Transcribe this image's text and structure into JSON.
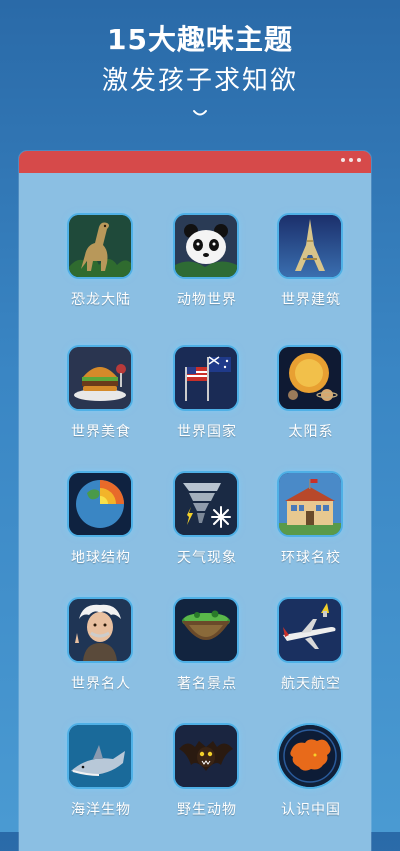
{
  "headline": {
    "title": "15大趣味主题",
    "subtitle": "激发孩子求知欲"
  },
  "topics": [
    {
      "label": "恐龙大陆",
      "icon": "dinosaur-icon"
    },
    {
      "label": "动物世界",
      "icon": "panda-icon"
    },
    {
      "label": "世界建筑",
      "icon": "eiffel-tower-icon"
    },
    {
      "label": "世界美食",
      "icon": "burger-icon"
    },
    {
      "label": "世界国家",
      "icon": "flags-icon"
    },
    {
      "label": "太阳系",
      "icon": "planets-icon"
    },
    {
      "label": "地球结构",
      "icon": "earth-core-icon"
    },
    {
      "label": "天气现象",
      "icon": "tornado-snow-icon"
    },
    {
      "label": "环球名校",
      "icon": "school-building-icon"
    },
    {
      "label": "世界名人",
      "icon": "einstein-icon"
    },
    {
      "label": "著名景点",
      "icon": "floating-island-icon"
    },
    {
      "label": "航天航空",
      "icon": "airplane-rocket-icon"
    },
    {
      "label": "海洋生物",
      "icon": "shark-icon"
    },
    {
      "label": "野生动物",
      "icon": "bat-icon"
    },
    {
      "label": "认识中国",
      "icon": "china-map-icon"
    }
  ]
}
